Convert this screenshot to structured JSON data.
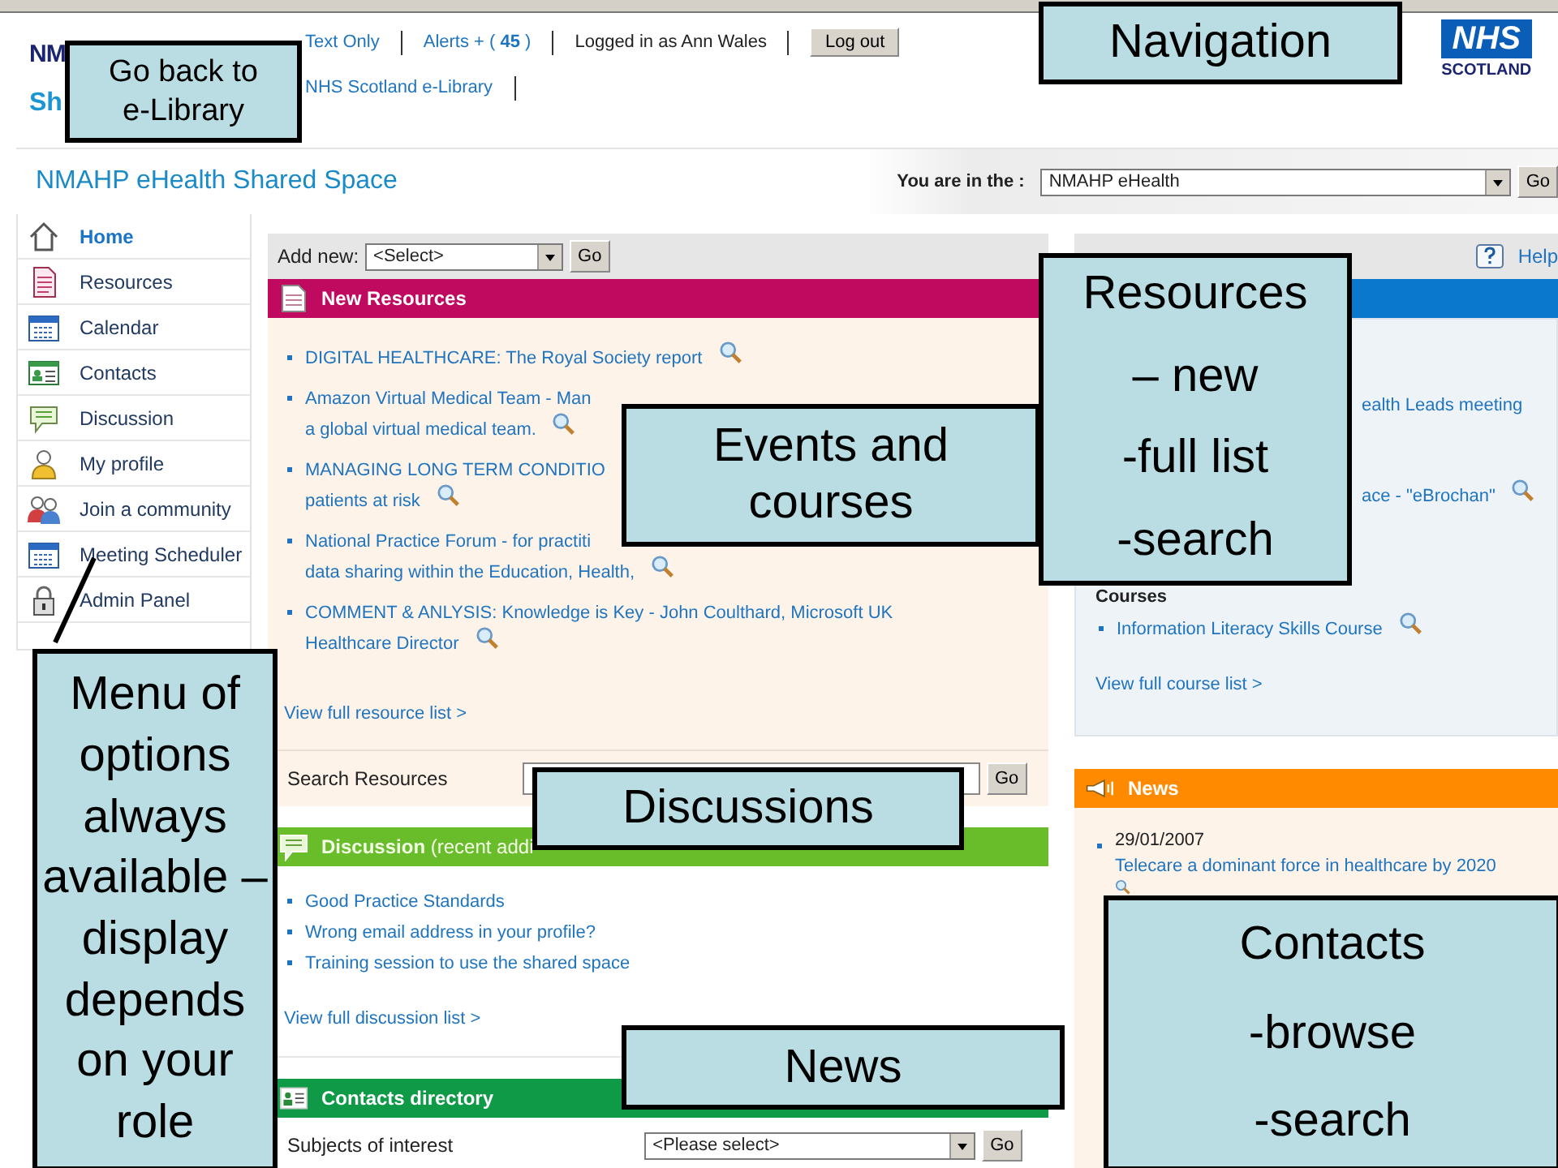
{
  "header": {
    "logo_lines": [
      "NM",
      "Sh"
    ],
    "text_only": "Text Only",
    "alerts": "Alerts + ( **45** )",
    "user": "Logged in as Ann Wales",
    "logout": "Log out",
    "library": "NHS Scotland e-Library",
    "nhs": "NHS",
    "nhs_sub": "SCOTLAND"
  },
  "title": "NMAHP eHealth Shared Space",
  "location": {
    "label": "You are in the :",
    "value": "NMAHP eHealth",
    "button": "Go"
  },
  "sidebar": [
    {
      "label": "Home",
      "selected": true
    },
    {
      "label": "Resources",
      "selected": false
    },
    {
      "label": "Calendar",
      "selected": false
    },
    {
      "label": "Contacts",
      "selected": false
    },
    {
      "label": "Discussion",
      "selected": false
    },
    {
      "label": "My profile",
      "selected": false
    },
    {
      "label": "Join a community",
      "selected": false
    },
    {
      "label": "Meeting Scheduler",
      "selected": false
    },
    {
      "label": "Admin Panel",
      "selected": false
    }
  ],
  "add_new": {
    "label": "Add new:",
    "value": "<Select>",
    "button": "Go"
  },
  "help": "Help",
  "resources": {
    "title": "New Resources",
    "items": [
      {
        "lines": [
          "DIGITAL HEALTHCARE: The Royal Society report"
        ]
      },
      {
        "lines": [
          "Amazon Virtual Medical Team - Man",
          "a global virtual medical team."
        ]
      },
      {
        "lines": [
          "MANAGING LONG TERM CONDITIO",
          "patients at risk"
        ]
      },
      {
        "lines": [
          "National Practice Forum - for practiti",
          "data sharing within the Education, Health,"
        ]
      },
      {
        "lines": [
          "COMMENT & ANLYSIS: Knowledge is Key - John Coulthard, Microsoft UK",
          "Healthcare Director"
        ]
      }
    ],
    "more": "View full resource list >",
    "search_label": "Search Resources",
    "search_button": "Go"
  },
  "discussion": {
    "title": "**Discussion** (recent addi",
    "items": [
      "Good Practice Standards",
      "Wrong email address in your profile?",
      "Training session to use the shared space"
    ],
    "more": "View full discussion list >"
  },
  "contacts": {
    "title": "Contacts directory",
    "label": "Subjects of interest",
    "value": "<Please select>",
    "button": "Go"
  },
  "events": {
    "items": [
      {
        "text": "ealth Leads meeting",
        "search_icon": false
      },
      {
        "text": "ace - \"eBrochan\"",
        "search_icon": true
      }
    ],
    "courses_title": "Courses",
    "courses": [
      "Information Literacy Skills Course"
    ],
    "more": "View full course list >"
  },
  "news": {
    "title": "News",
    "items": [
      {
        "date": "29/01/2007",
        "text": "Telecare a dominant force in healthcare by 2020"
      }
    ]
  },
  "callouts": [
    {
      "lines": [
        "Go back to",
        "e-Library"
      ]
    },
    {
      "lines": [
        "Navigation"
      ]
    },
    {
      "lines": [
        "Resources",
        "– new",
        "-full list",
        "-search"
      ]
    },
    {
      "lines": [
        "Events and courses"
      ]
    },
    {
      "lines": [
        "Menu of options always available – display depends on your role"
      ]
    },
    {
      "lines": [
        "Discussions"
      ]
    },
    {
      "lines": [
        "News"
      ]
    },
    {
      "lines": [
        "Contacts",
        "-browse",
        "-search"
      ]
    }
  ]
}
